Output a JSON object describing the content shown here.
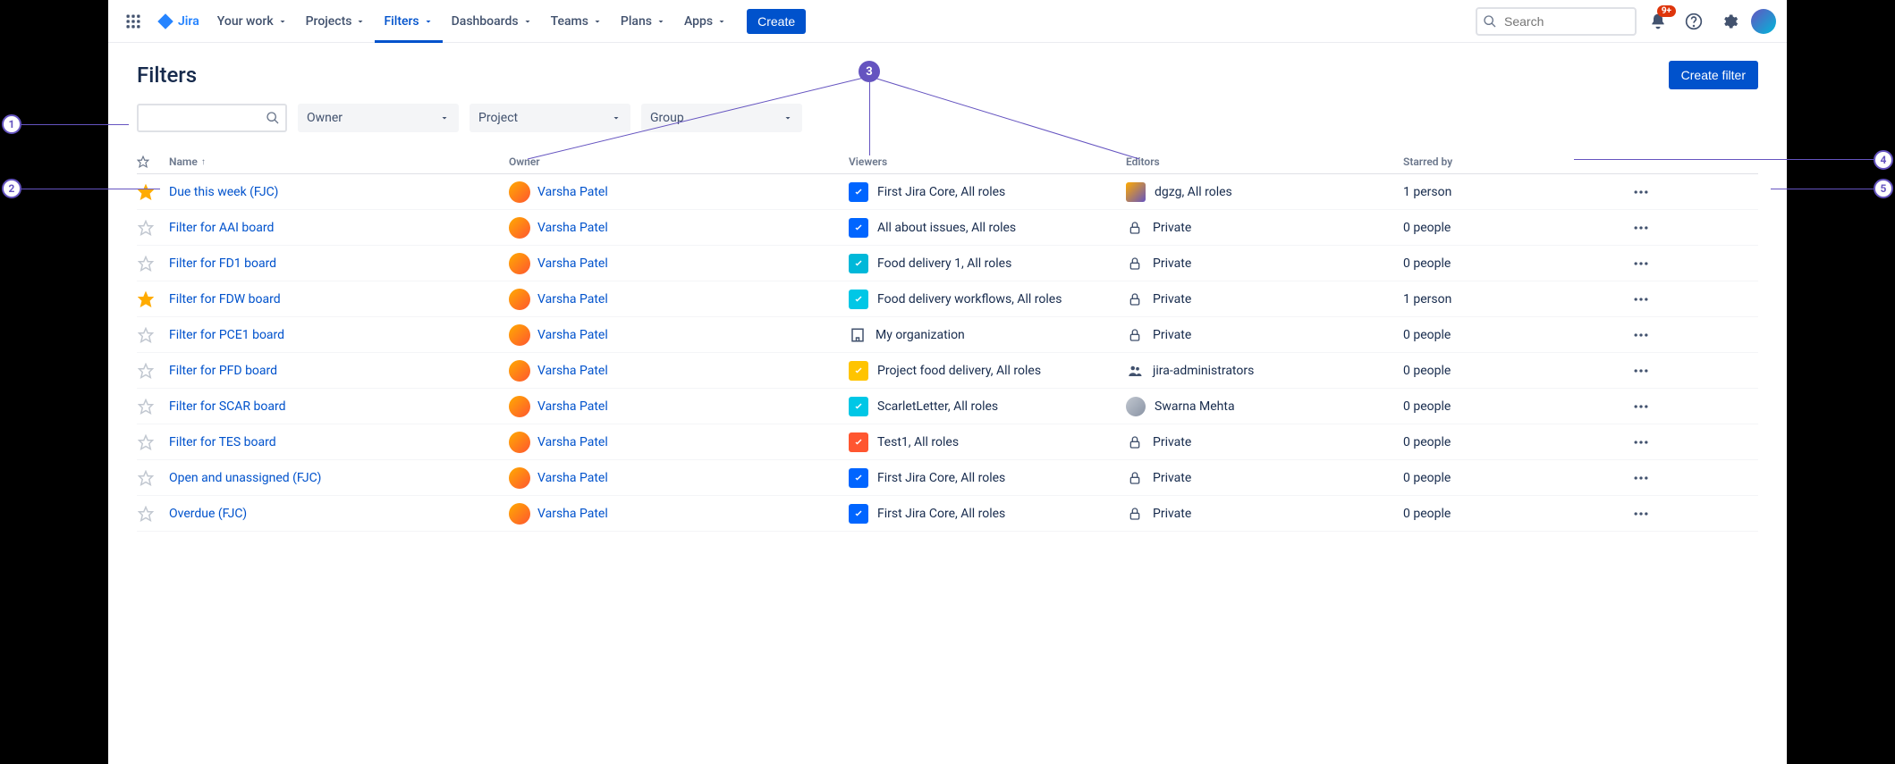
{
  "nav": {
    "product": "Jira",
    "items": [
      "Your work",
      "Projects",
      "Filters",
      "Dashboards",
      "Teams",
      "Plans",
      "Apps"
    ],
    "active_index": 2,
    "create": "Create",
    "search_placeholder": "Search",
    "notif_badge": "9+"
  },
  "page": {
    "title": "Filters",
    "create_filter": "Create filter"
  },
  "filterbar": {
    "owner": "Owner",
    "project": "Project",
    "group": "Group"
  },
  "columns": {
    "name": "Name",
    "owner": "Owner",
    "viewers": "Viewers",
    "editors": "Editors",
    "starred_by": "Starred by"
  },
  "owner_name": "Varsha Patel",
  "rows": [
    {
      "starred": true,
      "name": "Due this week (FJC)",
      "viewers_icon": "rocket-blue",
      "viewers": "First Jira Core, All roles",
      "editors_icon": "app-color",
      "editors": "dgzg, All roles",
      "starred_by": "1 person"
    },
    {
      "starred": false,
      "name": "Filter for AAI board",
      "viewers_icon": "rocket-blue",
      "viewers": "All about issues, All roles",
      "editors_icon": "lock",
      "editors": "Private",
      "starred_by": "0 people"
    },
    {
      "starred": false,
      "name": "Filter for FD1 board",
      "viewers_icon": "food-teal",
      "viewers": "Food delivery 1, All roles",
      "editors_icon": "lock",
      "editors": "Private",
      "starred_by": "0 people"
    },
    {
      "starred": true,
      "name": "Filter for FDW board",
      "viewers_icon": "note-cyan",
      "viewers": "Food delivery workflows, All roles",
      "editors_icon": "lock",
      "editors": "Private",
      "starred_by": "1 person"
    },
    {
      "starred": false,
      "name": "Filter for PCE1 board",
      "viewers_icon": "building",
      "viewers": "My organization",
      "editors_icon": "lock",
      "editors": "Private",
      "starred_by": "0 people"
    },
    {
      "starred": false,
      "name": "Filter for PFD board",
      "viewers_icon": "bot-yellow",
      "viewers": "Project food delivery, All roles",
      "editors_icon": "group",
      "editors": "jira-administrators",
      "starred_by": "0 people"
    },
    {
      "starred": false,
      "name": "Filter for SCAR board",
      "viewers_icon": "note-cyan",
      "viewers": "ScarletLetter, All roles",
      "editors_icon": "avatar",
      "editors": "Swarna Mehta",
      "starred_by": "0 people"
    },
    {
      "starred": false,
      "name": "Filter for TES board",
      "viewers_icon": "stack-orange",
      "viewers": "Test1, All roles",
      "editors_icon": "lock",
      "editors": "Private",
      "starred_by": "0 people"
    },
    {
      "starred": false,
      "name": "Open and unassigned (FJC)",
      "viewers_icon": "rocket-blue",
      "viewers": "First Jira Core, All roles",
      "editors_icon": "lock",
      "editors": "Private",
      "starred_by": "0 people"
    },
    {
      "starred": false,
      "name": "Overdue (FJC)",
      "viewers_icon": "rocket-blue",
      "viewers": "First Jira Core, All roles",
      "editors_icon": "lock",
      "editors": "Private",
      "starred_by": "0 people"
    }
  ],
  "callouts": {
    "c1": "1",
    "c2": "2",
    "c3": "3",
    "c4": "4",
    "c5": "5"
  }
}
